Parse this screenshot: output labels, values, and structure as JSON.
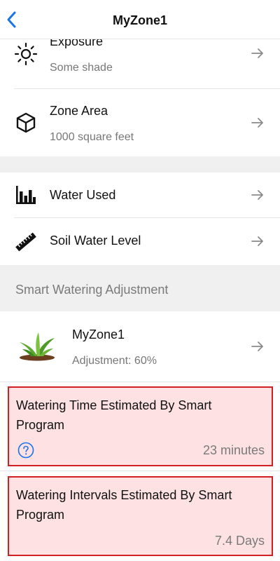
{
  "header": {
    "title": "MyZone1"
  },
  "details": [
    {
      "label": "Exposure",
      "sub": "Some shade",
      "icon": "sun-icon"
    },
    {
      "label": "Zone Area",
      "sub": "1000  square feet",
      "icon": "cube-icon"
    }
  ],
  "reports": [
    {
      "label": "Water Used",
      "icon": "bar-chart-icon"
    },
    {
      "label": "Soil Water Level",
      "icon": "ruler-icon"
    }
  ],
  "smart": {
    "section_label": "Smart Watering Adjustment",
    "zone_name": "MyZone1",
    "adjustment": "Adjustment: 60%",
    "zone_icon": "plant-icon"
  },
  "estimates": [
    {
      "title": "Watering Time Estimated By Smart Program",
      "value": "23 minutes",
      "help_icon": "question-circle-icon"
    },
    {
      "title": "Watering Intervals Estimated By Smart Program",
      "value": "7.4 Days"
    }
  ],
  "colors": {
    "accent": "#1a73e8",
    "highlight_border": "#d21f26",
    "highlight_fill": "#fde1e3",
    "muted": "#7a7a7a"
  }
}
